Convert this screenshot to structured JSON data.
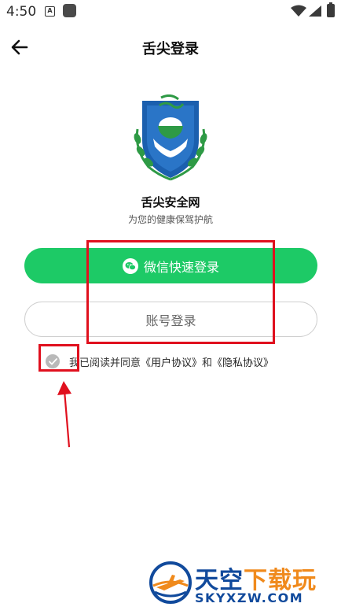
{
  "status_bar": {
    "time": "4:50",
    "notification_letter": "A"
  },
  "header": {
    "title": "舌尖登录"
  },
  "app": {
    "name": "舌尖安全网",
    "slogan": "为您的健康保驾护航"
  },
  "buttons": {
    "wechat_login": "微信快速登录",
    "account_login": "账号登录"
  },
  "agreement": {
    "checked": true,
    "prefix": "我已阅读并同意",
    "user_agreement": "《用户协议》",
    "conjunction": "和",
    "privacy_agreement": "《隐私协议》"
  },
  "colors": {
    "primary_green": "#1dca66",
    "annotation_red": "#e0101e",
    "logo_blue": "#1b5fae",
    "logo_green": "#2e9a45"
  },
  "watermark": {
    "title_part1": "天空",
    "title_part2": "下载玩",
    "domain": "SKYXZW.COM"
  }
}
